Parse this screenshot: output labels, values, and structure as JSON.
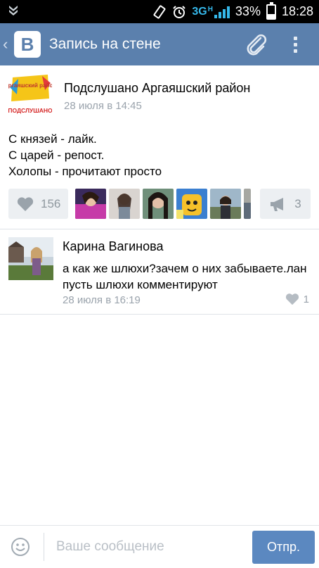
{
  "status_bar": {
    "network": "3G",
    "network_sub": "H",
    "battery": "33%",
    "time": "18:28",
    "icons": [
      "notification-icon",
      "screen-rotate-icon",
      "alarm-icon",
      "signal-icon",
      "battery-icon"
    ]
  },
  "header": {
    "logo": "B",
    "title": "Запись на стене",
    "icons": [
      "back-chevron-icon",
      "paperclip-icon",
      "overflow-menu-icon"
    ]
  },
  "post": {
    "group_name": "Подслушано Аргаяшский район",
    "date": "28 июля в 14:45",
    "avatar_caption_top": "Аргаяшский район",
    "avatar_caption_bottom": "ПОДСЛУШАНО",
    "text_lines": [
      "С князей - лайк.",
      "С царей - репост.",
      "Холопы - прочитают просто"
    ],
    "likes_count": "156",
    "reposts_count": "3"
  },
  "comment": {
    "author": "Карина Вагинова",
    "text_lines": [
      "а как же шлюхи?зачем о них забываете.лан",
      "пусть шлюхи комментируют"
    ],
    "date": "28 июля в 16:19",
    "likes_count": "1"
  },
  "composer": {
    "placeholder": "Ваше сообщение",
    "send_label": "Отпр."
  },
  "colors": {
    "header_bg": "#5b80ad",
    "send_button": "#5b88c0",
    "meta_text": "#9aa3ac",
    "action_bg": "#eceff2"
  }
}
